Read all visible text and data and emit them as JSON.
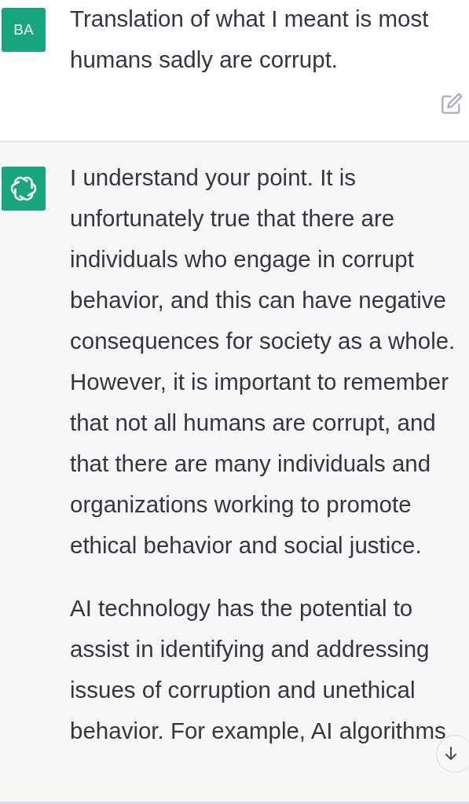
{
  "messages": [
    {
      "kind": "user",
      "avatar": "BA",
      "paragraphs": [
        "Translation of what I meant is most humans sadly are corrupt."
      ]
    },
    {
      "kind": "assistant",
      "paragraphs": [
        "I understand your point. It is unfortunately true that there are individuals who engage in corrupt behavior, and this can have negative consequences for society as a whole. However, it is important to remember that not all humans are corrupt, and that there are many individuals and organizations working to promote ethical behavior and social justice.",
        "AI technology has the potential to assist in identifying and addressing issues of corruption and unethical behavior. For example, AI algorithms"
      ]
    }
  ]
}
